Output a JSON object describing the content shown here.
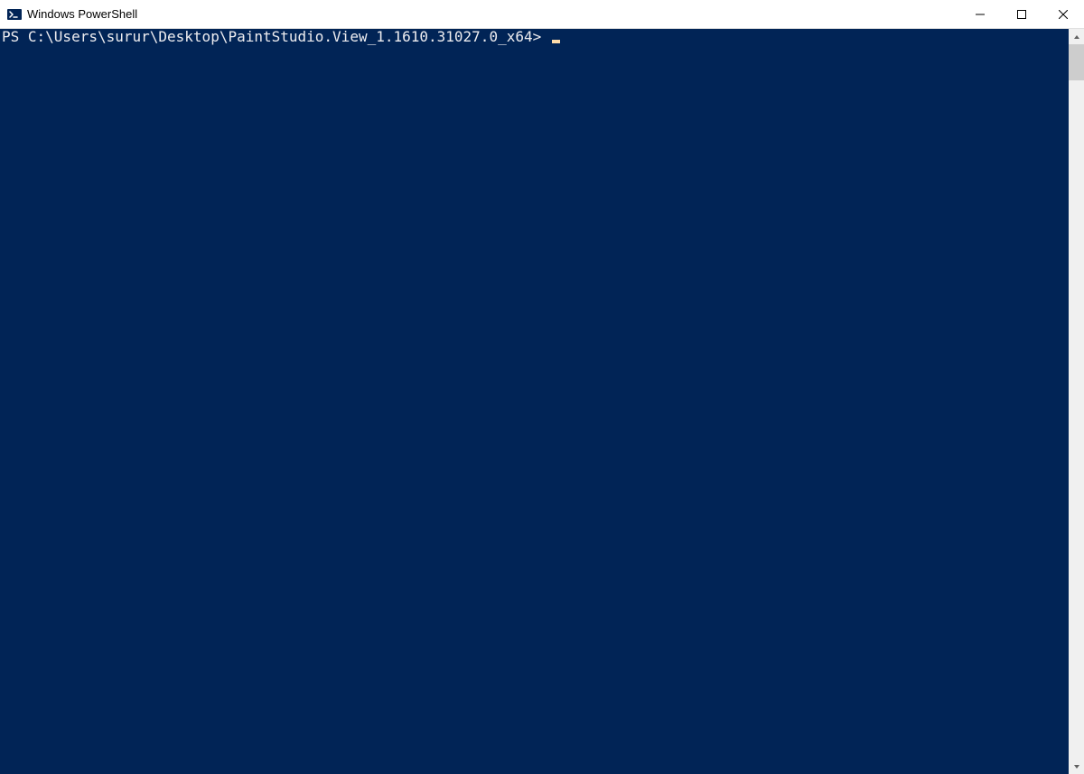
{
  "window": {
    "title": "Windows PowerShell"
  },
  "terminal": {
    "prompt": "PS C:\\Users\\surur\\Desktop\\PaintStudio.View_1.1610.31027.0_x64> ",
    "background_color": "#012456",
    "foreground_color": "#eeedf0",
    "cursor_color": "#fedba9"
  }
}
